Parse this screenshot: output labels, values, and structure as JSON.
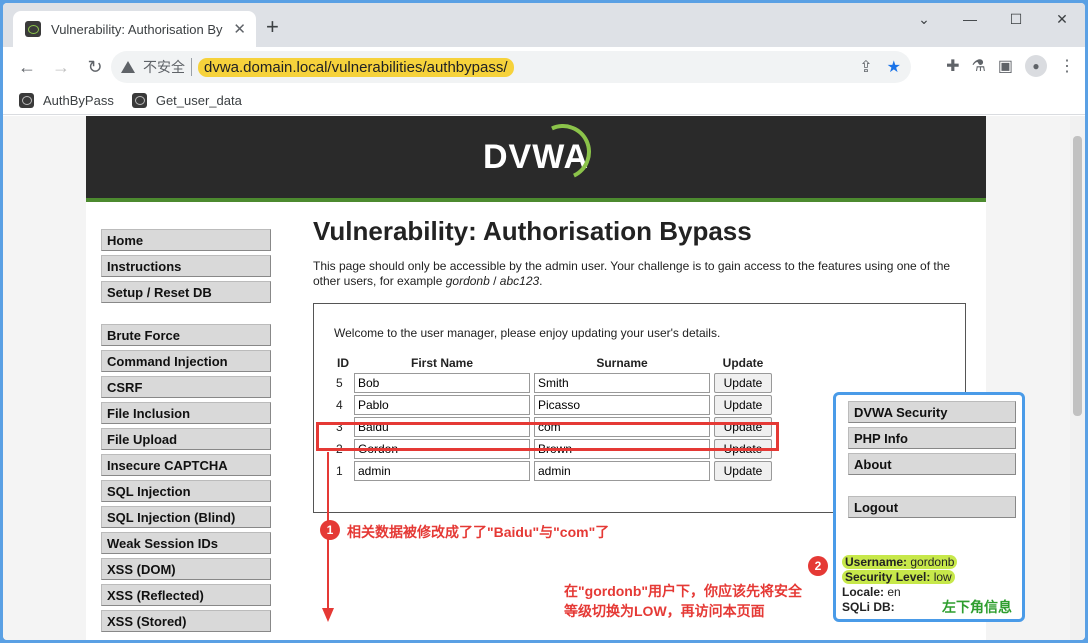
{
  "browser": {
    "tab_title": "Vulnerability: Authorisation By",
    "insecure_label": "不安全",
    "url": "dvwa.domain.local/vulnerabilities/authbypass/",
    "bookmarks": [
      "AuthByPass",
      "Get_user_data"
    ]
  },
  "page": {
    "logo": "DVWA",
    "menu_group1": [
      "Home",
      "Instructions",
      "Setup / Reset DB"
    ],
    "menu_group2": [
      "Brute Force",
      "Command Injection",
      "CSRF",
      "File Inclusion",
      "File Upload",
      "Insecure CAPTCHA",
      "SQL Injection",
      "SQL Injection (Blind)",
      "Weak Session IDs",
      "XSS (DOM)",
      "XSS (Reflected)",
      "XSS (Stored)"
    ],
    "title": "Vulnerability: Authorisation Bypass",
    "intro_a": "This page should only be accessible by the admin user. Your challenge is to gain access to the features using one of the other users, for example ",
    "intro_user": "gordonb",
    "intro_sep": " / ",
    "intro_pass": "abc123",
    "intro_end": ".",
    "welcome": "Welcome to the user manager, please enjoy updating your user's details.",
    "table_headers": [
      "ID",
      "First Name",
      "Surname",
      "Update"
    ],
    "rows": [
      {
        "id": "5",
        "first": "Bob",
        "surname": "Smith",
        "button": "Update"
      },
      {
        "id": "4",
        "first": "Pablo",
        "surname": "Picasso",
        "button": "Update"
      },
      {
        "id": "3",
        "first": "Baidu",
        "surname": "com",
        "button": "Update"
      },
      {
        "id": "2",
        "first": "Gordon",
        "surname": "Brown",
        "button": "Update"
      },
      {
        "id": "1",
        "first": "admin",
        "surname": "admin",
        "button": "Update"
      }
    ],
    "right_menu": [
      "DVWA Security",
      "PHP Info",
      "About",
      "Logout"
    ],
    "info": {
      "username_label": "Username:",
      "username": "gordonb",
      "security_label": "Security Level:",
      "security": "low",
      "locale_label": "Locale:",
      "locale": "en",
      "sqli_label": "SQLi DB:"
    }
  },
  "annotations": {
    "badge1": "1",
    "note1": "相关数据被修改成了了\"Baidu\"与\"com\"了",
    "badge2": "2",
    "note2_line1": "在\"gordonb\"用户下，你应该先将安全",
    "note2_line2": "等级切换为LOW，再访问本页面",
    "corner_label": "左下角信息"
  }
}
